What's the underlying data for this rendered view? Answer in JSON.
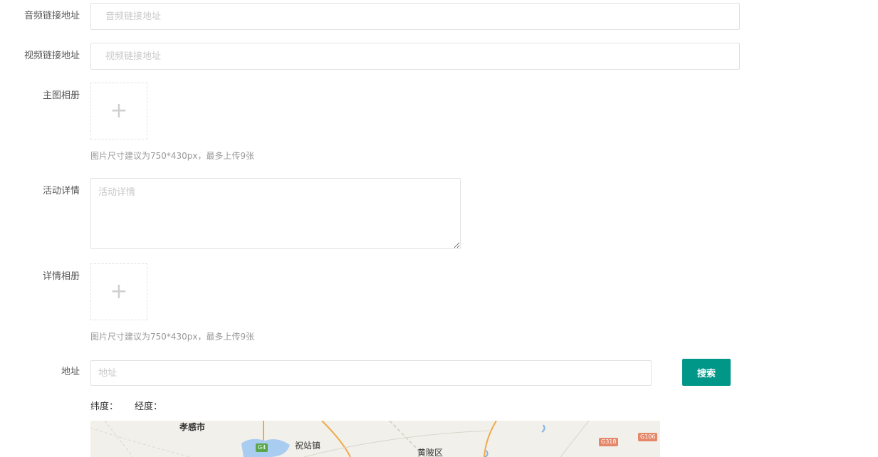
{
  "form": {
    "audio_url": {
      "label": "音频链接地址",
      "placeholder": "音频链接地址"
    },
    "video_url": {
      "label": "视频链接地址",
      "placeholder": "视频链接地址"
    },
    "main_album": {
      "label": "主图相册",
      "plus": "+",
      "hint": "图片尺寸建议为750*430px，最多上传9张"
    },
    "activity_detail": {
      "label": "活动详情",
      "placeholder": "活动详情"
    },
    "detail_album": {
      "label": "详情相册",
      "plus": "+",
      "hint": "图片尺寸建议为750*430px，最多上传9张"
    },
    "address": {
      "label": "地址",
      "placeholder": "地址",
      "search_label": "搜索"
    },
    "latitude_label": "纬度：",
    "longitude_label": "经度："
  },
  "map": {
    "places": [
      "孝感市",
      "祝站镇",
      "黄陂区"
    ],
    "road_badges": [
      "G4",
      "G318",
      "G106"
    ]
  },
  "colors": {
    "accent": "#009688",
    "border": "#e2e2e2",
    "placeholder": "#c9c9c9",
    "map_bg": "#f2f0ea"
  }
}
